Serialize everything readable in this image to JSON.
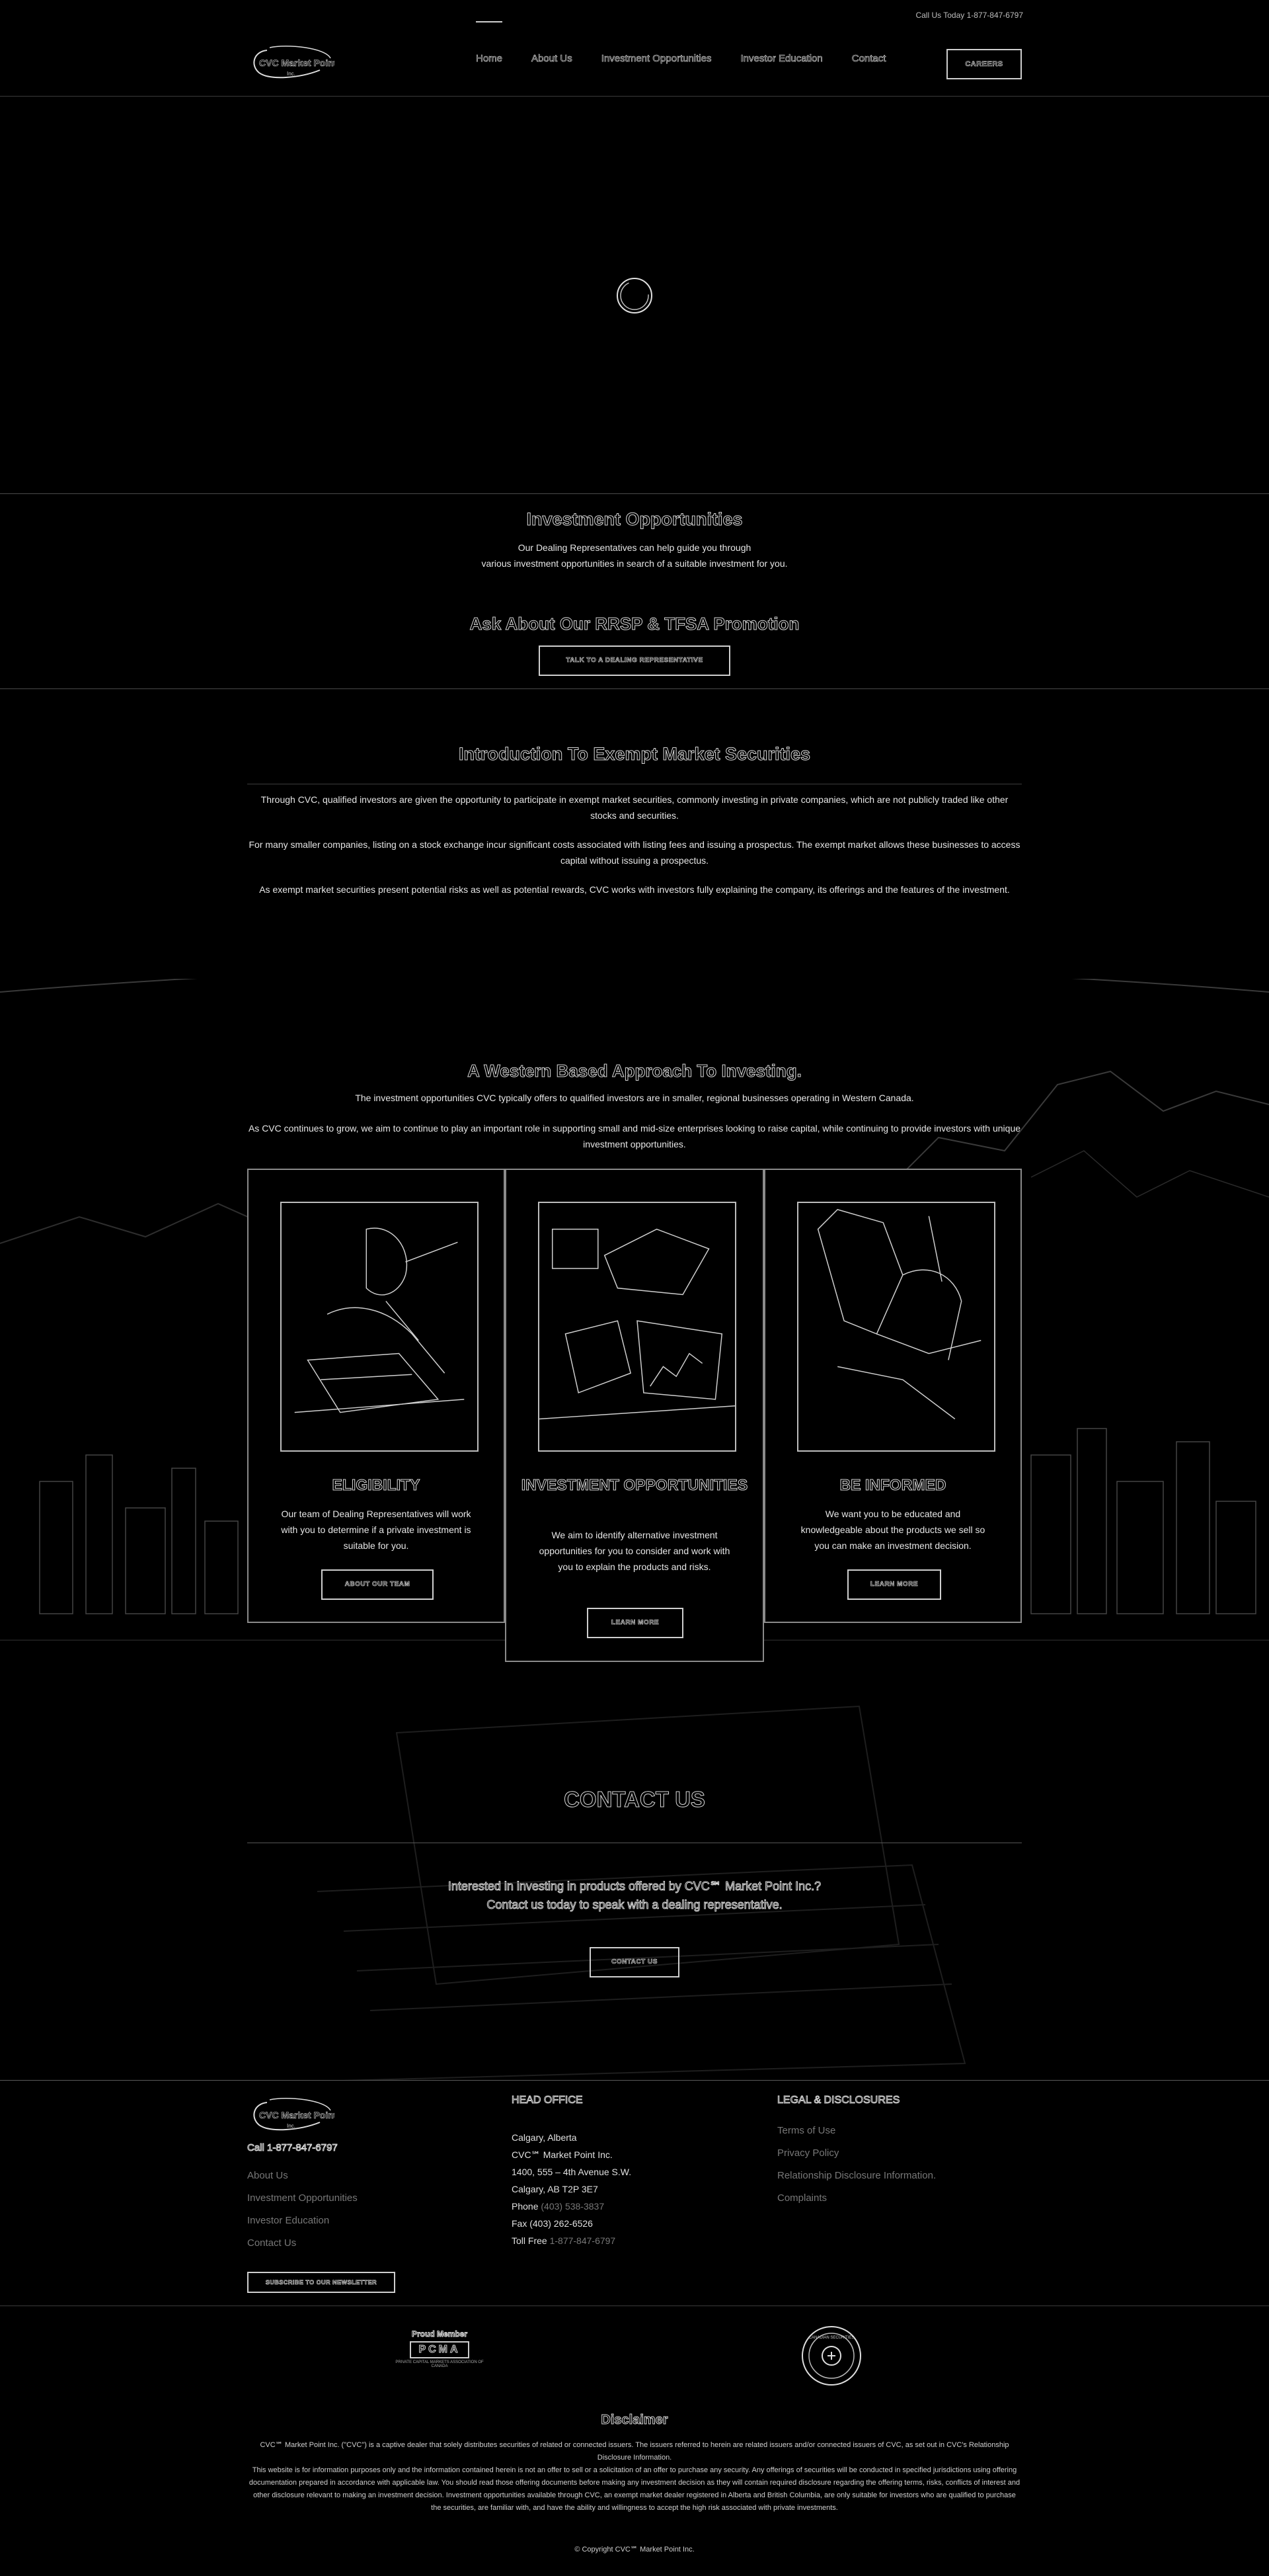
{
  "topbar": {
    "call": "Call Us Today 1-877-847-6797"
  },
  "brand": {
    "logo_text": "CVC Market Point",
    "logo_sub": "Inc."
  },
  "nav": {
    "items": [
      {
        "label": "Home"
      },
      {
        "label": "About Us"
      },
      {
        "label": "Investment Opportunities"
      },
      {
        "label": "Investor Education"
      },
      {
        "label": "Contact"
      }
    ],
    "careers": "CAREERS"
  },
  "investment_band": {
    "title": "Investment Opportunities",
    "line1": "Our Dealing Representatives can help guide you through",
    "line2": "various investment opportunities in search of a suitable investment for you.",
    "promo": "Ask About Our RRSP & TFSA Promotion",
    "button": "TALK TO A DEALING REPRESENTATIVE"
  },
  "intro": {
    "title": "Introduction To Exempt Market Securities",
    "p1": "Through CVC, qualified investors are given the opportunity to participate in exempt market securities, commonly investing in private companies, which are not publicly traded like other stocks and securities.",
    "p2": "For many smaller companies, listing on a stock exchange incur significant costs associated with listing fees and issuing a prospectus. The exempt market allows these businesses to access capital without issuing a prospectus.",
    "p3": "As exempt market securities present potential risks as well as potential rewards, CVC works with investors fully explaining the company, its offerings and the features of the investment."
  },
  "western": {
    "title": "A Western Based Approach To Investing.",
    "sub1": "The investment opportunities CVC typically offers to qualified investors are in smaller, regional businesses operating in Western Canada.",
    "sub2": "As CVC continues to grow, we aim to continue to play an important role in supporting small and mid-size enterprises looking to raise capital, while continuing to provide investors with unique investment opportunities.",
    "cards": [
      {
        "title": "ELIGIBILITY",
        "text": "Our team of Dealing Representatives will work with you to determine if a private investment is suitable for you.",
        "button": "ABOUT OUR TEAM"
      },
      {
        "title": "INVESTMENT OPPORTUNITIES",
        "text": "We aim to identify alternative investment opportunities for you to consider and work with you to explain the products and risks.",
        "button": "LEARN MORE"
      },
      {
        "title": "BE INFORMED",
        "text": "We want you to be educated and knowledgeable about the products we sell so you can make an investment decision.",
        "button": "LEARN MORE"
      }
    ]
  },
  "contact": {
    "title": "CONTACT US",
    "line1": "Interested in investing in products offered by CVC℠ Market Point Inc.?",
    "line2": "Contact us today to speak with a dealing representative.",
    "button": "CONTACT US"
  },
  "footer": {
    "call": "Call 1-877-847-6797",
    "links": [
      "About Us",
      "Investment Opportunities",
      "Investor Education",
      "Contact Us"
    ],
    "subscribe": "SUBSCRIBE TO OUR NEWSLETTER",
    "head_office": {
      "title": "HEAD OFFICE",
      "city": "Calgary, Alberta",
      "company": "CVC℠ Market Point Inc.",
      "address": "1400, 555 – 4th Avenue S.W.",
      "postal": "Calgary, AB T2P 3E7",
      "phone_label": "Phone",
      "phone": "(403) 538-3837",
      "fax_label": "Fax",
      "fax": "(403) 262-6526",
      "tollfree_label": "Toll Free",
      "tollfree": "1-877-847-6797"
    },
    "legal": {
      "title": "LEGAL & DISCLOSURES",
      "links": [
        "Terms of Use",
        "Privacy Policy",
        "Relationship Disclosure Information.",
        "Complaints"
      ]
    }
  },
  "badges": {
    "pcma_tag": "Proud Member",
    "pcma_mark": "PCMA",
    "pcma_small": "PRIVATE CAPITAL MARKETS ASSOCIATION OF CANADA",
    "seal_text": "CANADIAN SECURITIES"
  },
  "disclaimer": {
    "title": "Disclaimer",
    "p1": "CVC℠ Market Point Inc. (\"CVC\") is a captive dealer that solely distributes securities of related or connected issuers. The issuers referred to herein are related issuers and/or connected issuers of CVC, as set out in CVC's Relationship Disclosure Information.",
    "p2": "This website is for information purposes only and the information contained herein is not an offer to sell or a solicitation of an offer to purchase any security. Any offerings of securities will be conducted in specified jurisdictions using offering documentation prepared in accordance with applicable law. You should read those offering documents before making any investment decision as they will contain required disclosure regarding the offering terms, risks, conflicts of interest and other disclosure relevant to making an investment decision. Investment opportunities available through CVC, an exempt market dealer registered in Alberta and British Columbia, are only suitable for investors who are qualified to purchase the securities, are familiar with, and have the ability and willingness to accept the high risk associated with private investments.",
    "copyright": "© Copyright CVC℠ Market Point Inc."
  }
}
